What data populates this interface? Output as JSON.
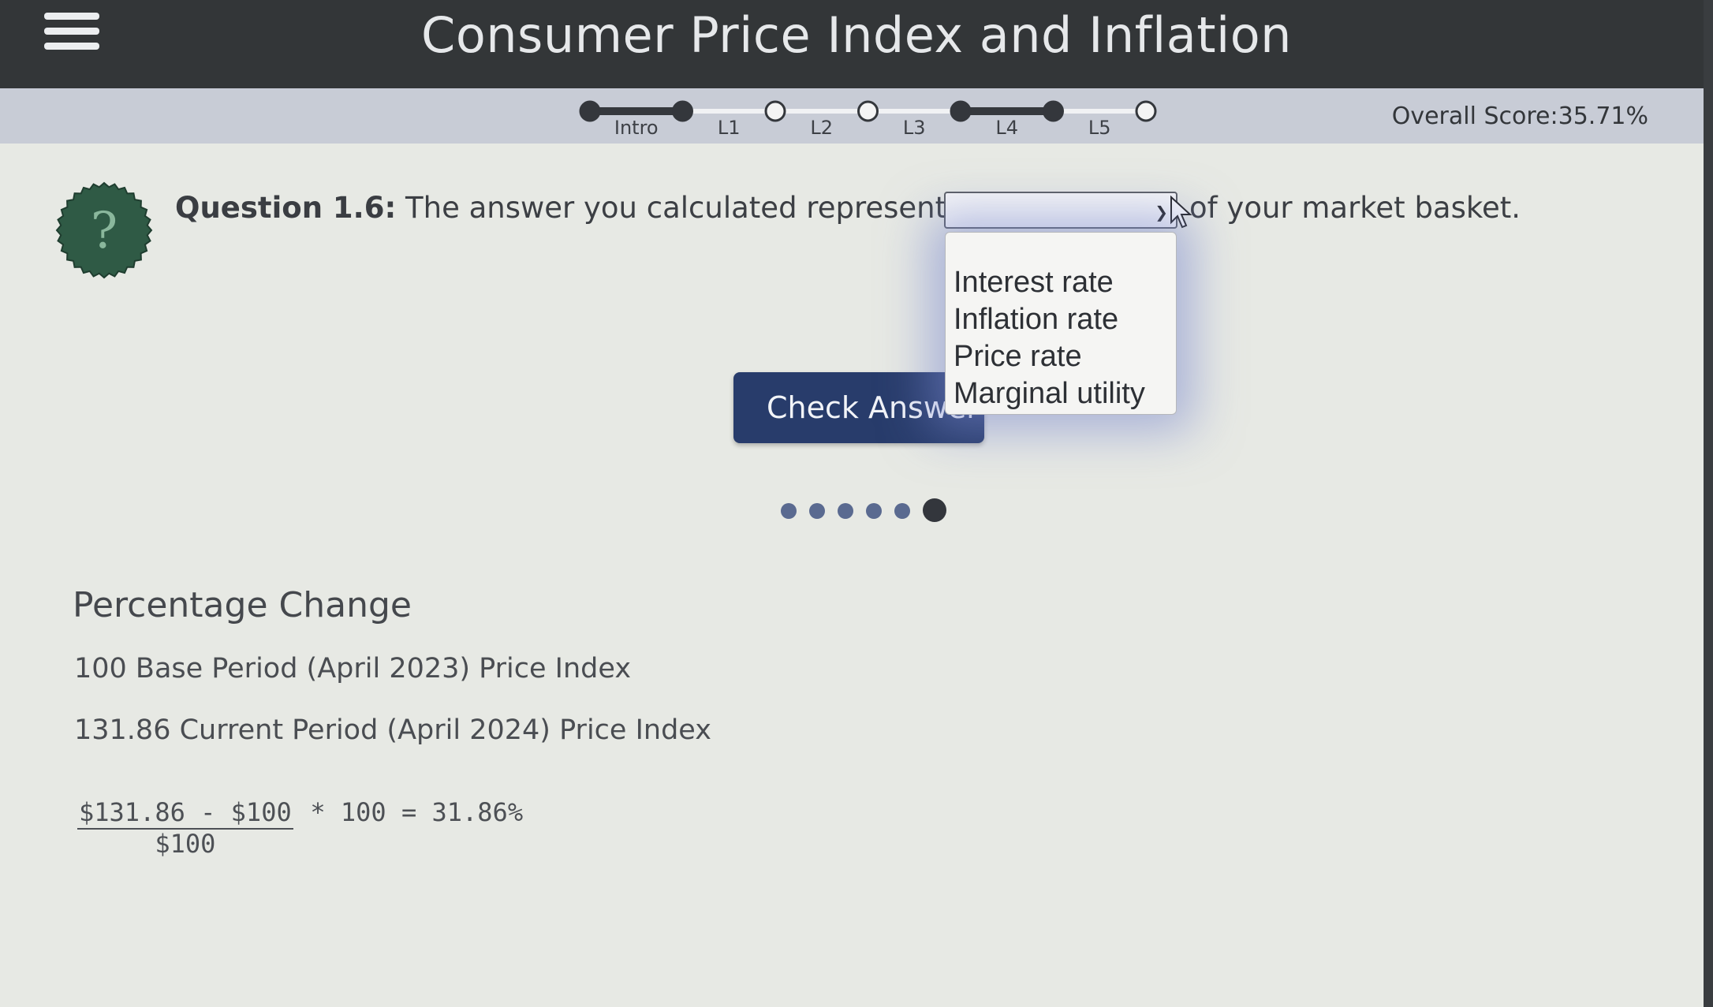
{
  "header": {
    "title": "Consumer Price Index and Inflation"
  },
  "progress": {
    "steps": [
      {
        "label": "Intro",
        "filled": true
      },
      {
        "label": "L1",
        "filled": true
      },
      {
        "label": "L2",
        "filled": false
      },
      {
        "label": "L3",
        "filled": false
      },
      {
        "label": "L4",
        "filled": true
      },
      {
        "label": "L5",
        "filled": true
      },
      {
        "label": "",
        "filled": false
      }
    ],
    "score_label": "Overall Score:",
    "score_value": "35.71%"
  },
  "question": {
    "number": "Question 1.6:",
    "text_before": "The answer you calculated represents the",
    "text_after": "of your market basket.",
    "badge_icon": "question-mark-icon",
    "badge_symbol": "?",
    "selected_value": ""
  },
  "dropdown": {
    "options": [
      "Interest rate",
      "Inflation rate",
      "Price rate",
      "Marginal utility"
    ]
  },
  "check_button": {
    "label": "Check Answer"
  },
  "pager": {
    "count": 6,
    "active_index": 5
  },
  "percentage_change": {
    "title": "Percentage Change",
    "line1": "100 Base Period (April 2023) Price Index",
    "line2": "131.86 Current Period (April 2024) Price Index",
    "formula_numerator": "$131.86 - $100",
    "formula_denominator": "$100",
    "formula_rest": "* 100 = 31.86%"
  },
  "colors": {
    "topbar": "#333638",
    "button": "#283c6b",
    "badge": "#2f5a45",
    "strip": "#c8ccd6"
  }
}
